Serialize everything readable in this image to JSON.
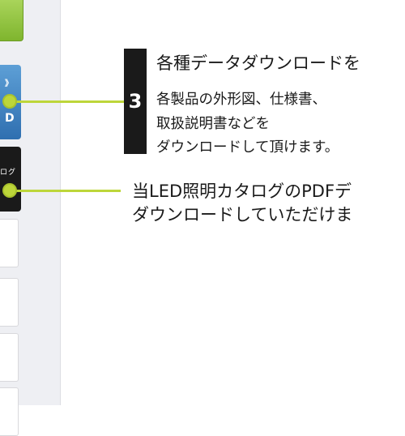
{
  "sidebar": {
    "blue_button_glyph_top": "》",
    "blue_button_glyph_bottom": "D",
    "black_button_text": "ログ"
  },
  "callout": {
    "step_number": "3",
    "title": "各種データダウンロードを",
    "description_lines": [
      "各製品の外形図、仕様書、",
      "取扱説明書などを",
      "ダウンロードして頂けます。"
    ]
  },
  "catalog_note": {
    "lines": [
      "当LED照明カタログのPDFデ",
      "ダウンロードしていただけま"
    ]
  },
  "colors": {
    "accent_green": "#bdd63a",
    "badge_black": "#1a1a1a",
    "button_blue": "#2f6fb0",
    "sidebar_bg": "#eeeff3"
  }
}
